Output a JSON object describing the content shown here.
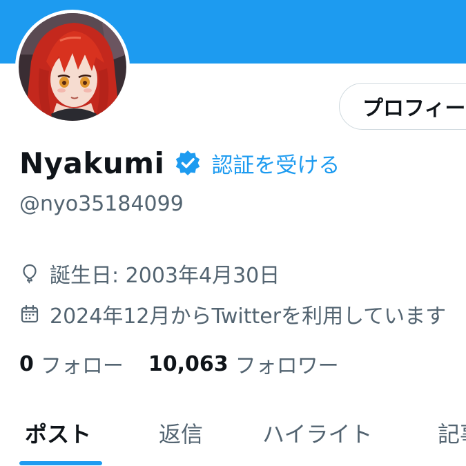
{
  "profile": {
    "display_name": "Nyakumi",
    "handle": "@nyo35184099",
    "get_verified": "認証を受ける",
    "edit_profile": "プロフィールを編集",
    "birthday": "誕生日: 2003年4月30日",
    "joined": "2024年12月からTwitterを利用しています"
  },
  "follow": {
    "following_count": "0",
    "following_label": "フォロー",
    "followers_count": "10,063",
    "followers_label": "フォロワー"
  },
  "tabs": [
    {
      "label": "ポスト",
      "active": true
    },
    {
      "label": "返信",
      "active": false
    },
    {
      "label": "ハイライト",
      "active": false
    },
    {
      "label": "記事",
      "active": false
    }
  ],
  "icons": {
    "verified": "verified-badge-icon",
    "birthday": "balloon-icon",
    "joined": "calendar-icon"
  },
  "colors": {
    "accent": "#1d9bf0",
    "text_primary": "#0f1419",
    "text_secondary": "#536471",
    "border": "#cfd9de"
  }
}
